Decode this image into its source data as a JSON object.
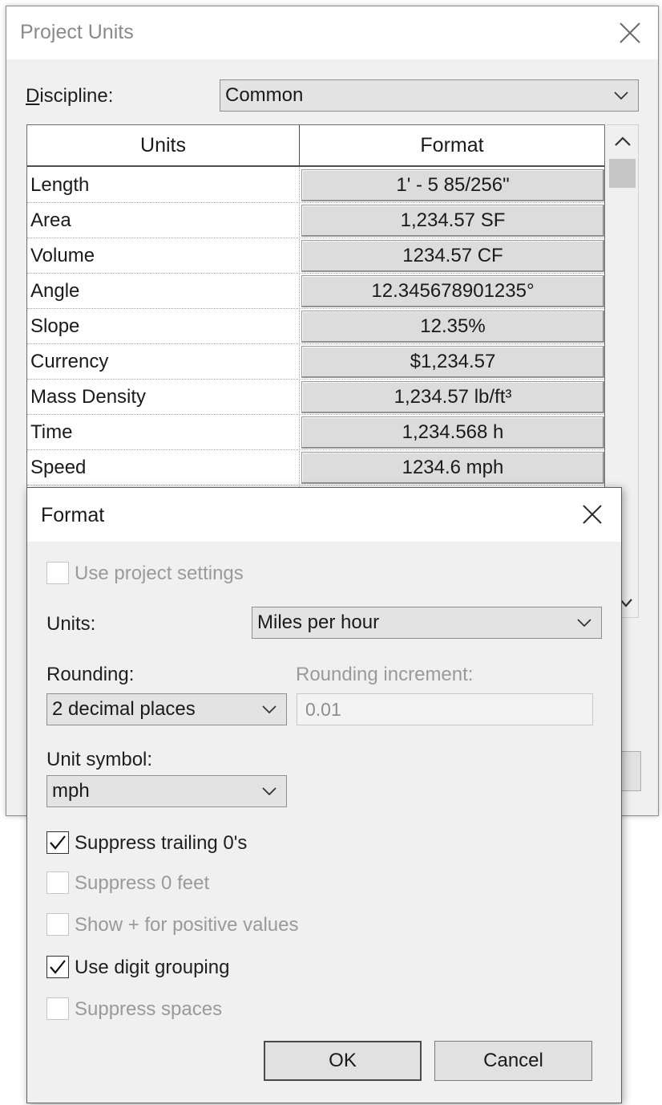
{
  "project_units": {
    "title": "Project Units",
    "discipline": {
      "label": "Discipline:",
      "value": "Common"
    },
    "table": {
      "headers": [
        "Units",
        "Format"
      ],
      "rows": [
        {
          "unit": "Length",
          "format": "1' - 5 85/256\""
        },
        {
          "unit": "Area",
          "format": "1,234.57 SF"
        },
        {
          "unit": "Volume",
          "format": "1234.57 CF"
        },
        {
          "unit": "Angle",
          "format": "12.345678901235°"
        },
        {
          "unit": "Slope",
          "format": "12.35%"
        },
        {
          "unit": "Currency",
          "format": "$1,234.57"
        },
        {
          "unit": "Mass Density",
          "format": "1,234.57 lb/ft³"
        },
        {
          "unit": "Time",
          "format": "1,234.568 h"
        },
        {
          "unit": "Speed",
          "format": "1234.6 mph"
        }
      ]
    }
  },
  "format_dialog": {
    "title": "Format",
    "use_project_settings": {
      "label": "Use project settings",
      "checked": false,
      "enabled": false
    },
    "units": {
      "label": "Units:",
      "value": "Miles per hour"
    },
    "rounding": {
      "label": "Rounding:",
      "value": "2 decimal places"
    },
    "rounding_increment": {
      "label": "Rounding increment:",
      "value": "0.01"
    },
    "unit_symbol": {
      "label": "Unit symbol:",
      "value": "mph"
    },
    "options": [
      {
        "label": "Suppress trailing 0's",
        "checked": true,
        "enabled": true
      },
      {
        "label": "Suppress 0 feet",
        "checked": false,
        "enabled": false
      },
      {
        "label": "Show + for positive values",
        "checked": false,
        "enabled": false
      },
      {
        "label": "Use digit grouping",
        "checked": true,
        "enabled": true
      },
      {
        "label": "Suppress spaces",
        "checked": false,
        "enabled": false
      }
    ],
    "buttons": {
      "ok": "OK",
      "cancel": "Cancel"
    }
  }
}
